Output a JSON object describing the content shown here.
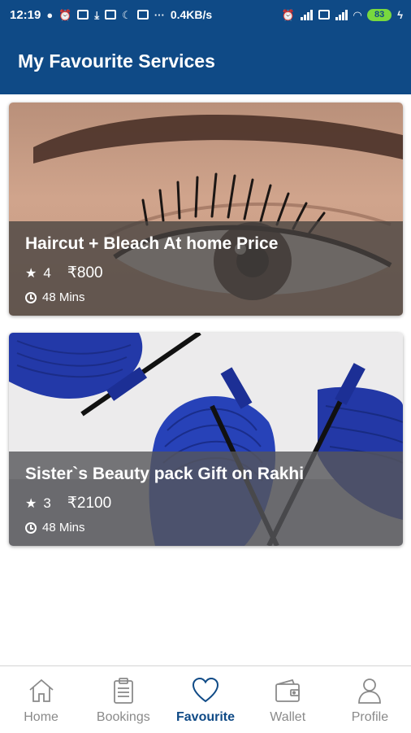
{
  "status_bar": {
    "time": "12:19",
    "net_speed": "0.4KB/s",
    "battery": "83"
  },
  "app_bar": {
    "title": "My Favourite Services"
  },
  "services": [
    {
      "title": "Haircut + Bleach At home Price",
      "rating": "4",
      "price": "₹800",
      "duration": "48 Mins",
      "image": "eye-lashes-photo"
    },
    {
      "title": "Sister`s Beauty pack Gift on Rakhi",
      "rating": "3",
      "price": "₹2100",
      "duration": "48 Mins",
      "image": "blue-mascara-photo"
    }
  ],
  "bottom_nav": {
    "items": [
      {
        "label": "Home",
        "icon": "home-icon"
      },
      {
        "label": "Bookings",
        "icon": "clipboard-icon"
      },
      {
        "label": "Favourite",
        "icon": "heart-icon",
        "active": true
      },
      {
        "label": "Wallet",
        "icon": "wallet-icon"
      },
      {
        "label": "Profile",
        "icon": "person-icon"
      }
    ]
  },
  "colors": {
    "primary": "#0f4a86",
    "inactive": "#8a8a8a",
    "battery": "#79d93e"
  }
}
